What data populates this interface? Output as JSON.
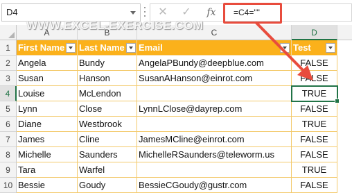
{
  "formula_bar": {
    "name_box": "D4",
    "cancel_icon": "✕",
    "enter_icon": "✓",
    "fx_label": "fx",
    "formula": "=C4=\"\""
  },
  "watermark": "WWW.EXCEL-EXERCISE.COM",
  "columns": [
    "A",
    "B",
    "C",
    "D"
  ],
  "selected_column": "D",
  "selected_row": "4",
  "header_row": {
    "row": "1",
    "cells": [
      "First Name",
      "Last Name",
      "Email",
      "Test"
    ]
  },
  "rows": [
    {
      "row": "2",
      "first": "Angela",
      "last": "Bundy",
      "email": "AngelaPBundy@deepblue.com",
      "test": "FALSE"
    },
    {
      "row": "3",
      "first": "Susan",
      "last": "Hanson",
      "email": "SusanAHanson@einrot.com",
      "test": "FALSE"
    },
    {
      "row": "4",
      "first": "Louise",
      "last": "McLendon",
      "email": "",
      "test": "TRUE"
    },
    {
      "row": "5",
      "first": "Lynn",
      "last": "Close",
      "email": "LynnLClose@dayrep.com",
      "test": "FALSE"
    },
    {
      "row": "6",
      "first": "Diane",
      "last": "Westbrook",
      "email": "",
      "test": "TRUE"
    },
    {
      "row": "7",
      "first": "James",
      "last": "Cline",
      "email": "JamesMCline@einrot.com",
      "test": "FALSE"
    },
    {
      "row": "8",
      "first": "Michelle",
      "last": "Saunders",
      "email": "MichelleRSaunders@teleworm.us",
      "test": "FALSE"
    },
    {
      "row": "9",
      "first": "Tara",
      "last": "Warfel",
      "email": "",
      "test": "TRUE"
    },
    {
      "row": "10",
      "first": "Bessie",
      "last": "Goudy",
      "email": "BessieCGoudy@gustr.com",
      "test": "FALSE"
    }
  ],
  "colors": {
    "header_fill": "#fbb11b",
    "excel_green": "#217346",
    "callout_red": "#e84c3d"
  }
}
